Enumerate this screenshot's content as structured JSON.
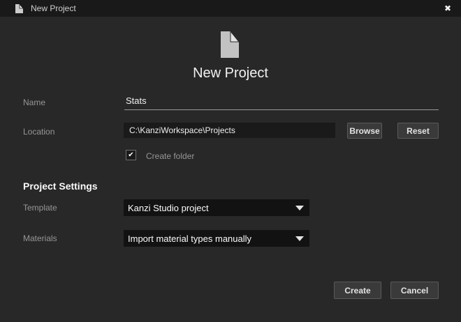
{
  "titlebar": {
    "title": "New Project"
  },
  "hero": {
    "title": "New Project"
  },
  "form": {
    "name": {
      "label": "Name",
      "value": "Stats"
    },
    "location": {
      "label": "Location",
      "value": "C:\\KanziWorkspace\\Projects",
      "browse": "Browse",
      "reset": "Reset"
    },
    "create_folder": {
      "label": "Create folder",
      "checked": true
    },
    "settings_heading": "Project Settings",
    "template": {
      "label": "Template",
      "value": "Kanzi Studio project"
    },
    "materials": {
      "label": "Materials",
      "value": "Import material types manually"
    }
  },
  "footer": {
    "create": "Create",
    "cancel": "Cancel"
  },
  "icons": {
    "close": "✖",
    "check": "✔",
    "document": "document-icon",
    "caret": "chevron-down-icon"
  },
  "colors": {
    "titlebar_bg": "#191919",
    "body_bg": "#282828",
    "field_bg": "#1a1a1a",
    "dropdown_bg": "#121212",
    "button_bg": "#3a3a3a",
    "button_border": "#5a5a5a",
    "label_text": "#969696",
    "value_text": "#f2f2f2"
  }
}
